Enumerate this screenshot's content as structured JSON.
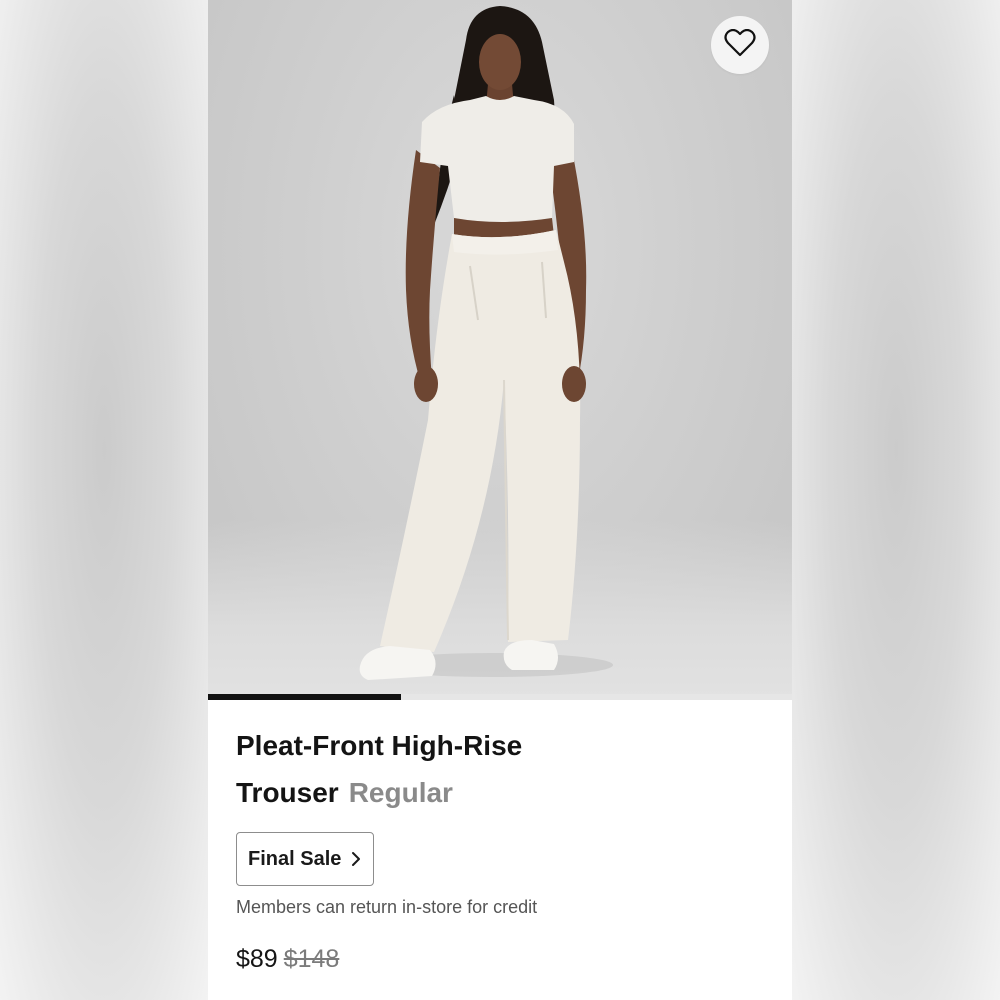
{
  "product": {
    "title_line1": "Pleat-Front High-Rise",
    "title_line2": "Trouser",
    "variant": "Regular",
    "sale_badge": "Final Sale",
    "return_note": "Members can return in-store for credit",
    "price_current": "$89",
    "price_original": "$148"
  },
  "gallery": {
    "image_progress": 0.33,
    "favorite_icon": "heart-outline-icon",
    "chevron_icon": "chevron-right-icon"
  },
  "colors": {
    "text_primary": "#141414",
    "text_variant": "#8a8a8a",
    "progress": "#111111"
  }
}
